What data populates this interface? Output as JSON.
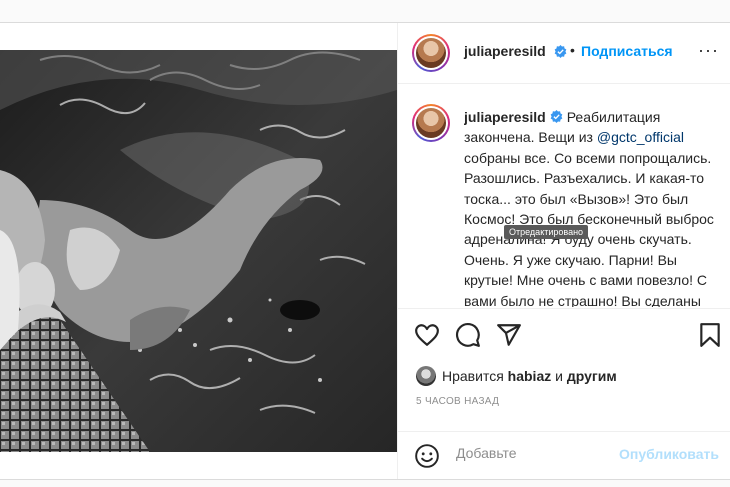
{
  "header": {
    "username": "juliaperesild",
    "dot": "•",
    "follow_label": "Подписаться",
    "more_label": "···"
  },
  "caption": {
    "username": "juliaperesild",
    "text_before": "Реабилитация закончена. Вещи из ",
    "mention": "@gctc_official",
    "text_after": " собраны все. Со всеми попрощались. Разошлись. Разъехались. И какая-то тоска... это был «Вызов»! Это был Космос! Это был бесконечный выброс адреналина! Я буду очень скучать. Очень. Я уже скучаю. Парни! Вы крутые! Мне очень с вами повезло! С вами было не страшно! Вы сделаны"
  },
  "tooltip": "Отредактировано",
  "likes": {
    "prefix": "Нравится ",
    "user": "habiaz",
    "middle": " и ",
    "others": "другим"
  },
  "timestamp": "5 ЧАСОВ НАЗАД",
  "comment": {
    "placeholder": "Добавьте",
    "publish_label": "Опубликовать"
  },
  "icons": [
    "heart-icon",
    "comment-icon",
    "share-icon",
    "bookmark-icon",
    "emoji-icon",
    "verified-icon",
    "more-icon"
  ],
  "colors": {
    "link": "#0095f6",
    "mention": "#00376b",
    "publish_disabled": "#b2dffc",
    "muted": "#8e8e8e",
    "text": "#262626"
  }
}
